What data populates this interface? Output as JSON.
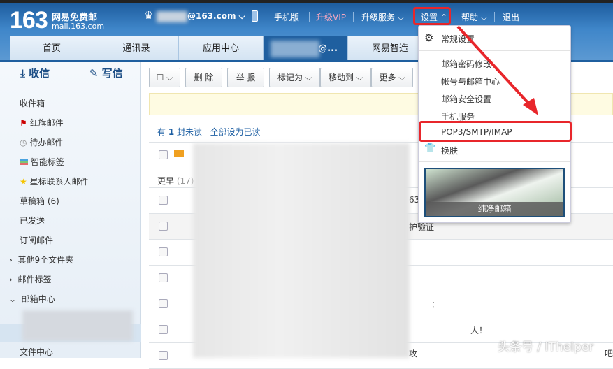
{
  "header": {
    "logo_number": "163",
    "logo_name": "网易免费邮",
    "logo_url": "mail.163.com",
    "account": "@163.com",
    "mobile": "手机版",
    "vip": "升级VIP",
    "upgrade": "升级服务",
    "settings": "设置",
    "help": "帮助",
    "logout": "退出"
  },
  "tabs": [
    {
      "label": "首页"
    },
    {
      "label": "通讯录"
    },
    {
      "label": "应用中心"
    },
    {
      "label": "@..."
    },
    {
      "label": "网易智造"
    }
  ],
  "sidebar": {
    "receive": "收信",
    "compose": "写信",
    "folders": [
      "收件箱",
      "红旗邮件",
      "待办邮件",
      "智能标签",
      "星标联系人邮件",
      "草稿箱 (6)",
      "已发送",
      "订阅邮件",
      "其他9个文件夹",
      "邮件标签",
      "邮箱中心",
      "文件中心"
    ]
  },
  "toolbar": {
    "delete": "删 除",
    "report": "举 报",
    "mark": "标记为",
    "move": "移动到",
    "more": "更多"
  },
  "list": {
    "unread_prefix": "有",
    "unread_count": "1",
    "unread_suffix": "封未读",
    "mark_all": "全部设为已读",
    "group": "更早",
    "group_count": "(17)",
    "snippets": [
      "63",
      "护验证",
      "：",
      "人！",
      "攻",
      "吧"
    ]
  },
  "menu": {
    "items": [
      "常规设置",
      "邮箱密码修改",
      "帐号与邮箱中心",
      "邮箱安全设置",
      "手机服务",
      "POP3/SMTP/IMAP",
      "换肤"
    ],
    "skin": "纯净邮箱"
  },
  "watermark": "头条号 / ITheIper",
  "colors": {
    "accent": "#1f5f9f",
    "highlight": "#e8262b",
    "vip": "#f7a8c0"
  }
}
